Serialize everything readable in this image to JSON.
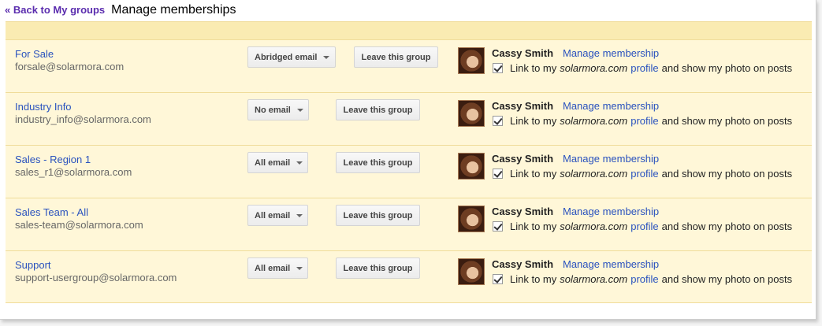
{
  "header": {
    "back_label": "« Back to My groups",
    "title": "Manage memberships"
  },
  "member": {
    "name": "Cassy Smith",
    "manage_label": "Manage membership",
    "link_prefix": "Link to my",
    "domain": "solarmora.com",
    "profile_label": "profile",
    "link_suffix": "and show my photo on posts",
    "checked": true
  },
  "leave_label": "Leave this group",
  "groups": [
    {
      "name": "For Sale",
      "email": "forsale@solarmora.com",
      "delivery": "Abridged email"
    },
    {
      "name": "Industry Info",
      "email": "industry_info@solarmora.com",
      "delivery": "No email"
    },
    {
      "name": "Sales - Region 1",
      "email": "sales_r1@solarmora.com",
      "delivery": "All email"
    },
    {
      "name": "Sales Team - All",
      "email": "sales-team@solarmora.com",
      "delivery": "All email"
    },
    {
      "name": "Support",
      "email": "support-usergroup@solarmora.com",
      "delivery": "All email"
    }
  ],
  "colors": {
    "row_bg": "#fff7d8",
    "band_bg": "#faebb2",
    "link": "#2a52be",
    "back_link": "#5a2cae"
  }
}
